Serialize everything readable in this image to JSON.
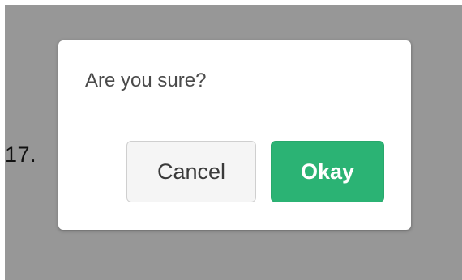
{
  "page": {
    "step_number": "17."
  },
  "dialog": {
    "message": "Are you sure?",
    "cancel_label": "Cancel",
    "okay_label": "Okay"
  },
  "colors": {
    "backdrop": "#979797",
    "dialog_background": "#ffffff",
    "okay_button": "#2bb374",
    "cancel_button": "#f5f5f5",
    "message_text": "#4a4a4a"
  }
}
